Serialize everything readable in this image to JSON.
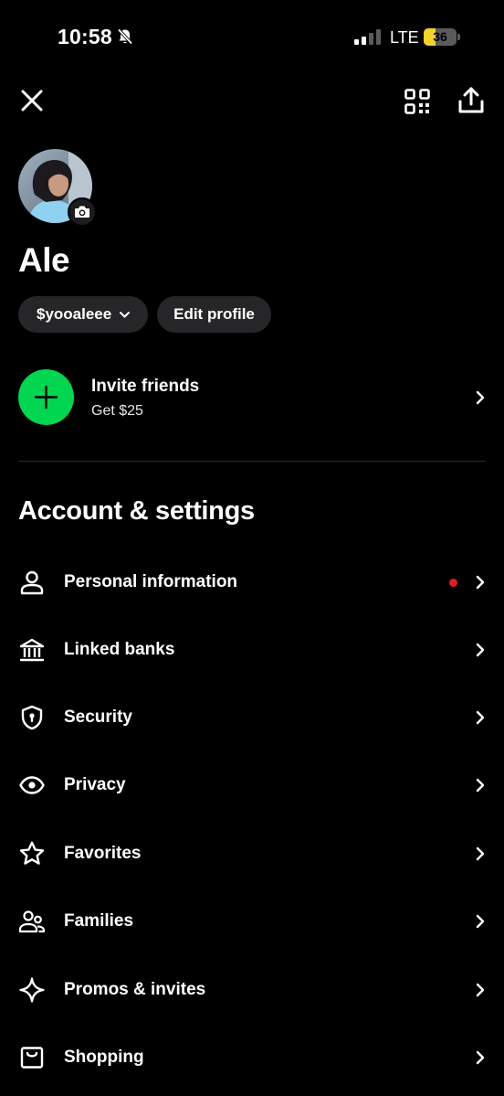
{
  "status_bar": {
    "time": "10:58",
    "network": "LTE",
    "battery_percent": "36",
    "battery_level": 0.36,
    "battery_color": "#f5d228",
    "icons": [
      "bell-slash-icon",
      "cellular-signal-icon",
      "battery-icon"
    ]
  },
  "top_bar": {
    "icons": [
      "close-icon",
      "qr-code-icon",
      "share-icon"
    ]
  },
  "profile": {
    "name": "Ale",
    "cashtag": "$yooaleee",
    "edit_label": "Edit profile",
    "icons": [
      "avatar-photo",
      "camera-icon",
      "chevron-down-icon"
    ]
  },
  "invite": {
    "title": "Invite friends",
    "subtitle": "Get $25",
    "accent_color": "#00d64f",
    "icon": "plus-icon"
  },
  "settings": {
    "section_title": "Account & settings",
    "items": [
      {
        "label": "Personal information",
        "icon": "person-icon",
        "notification": true
      },
      {
        "label": "Linked banks",
        "icon": "bank-icon"
      },
      {
        "label": "Security",
        "icon": "shield-icon"
      },
      {
        "label": "Privacy",
        "icon": "eye-icon"
      },
      {
        "label": "Favorites",
        "icon": "star-icon"
      },
      {
        "label": "Families",
        "icon": "family-icon"
      },
      {
        "label": "Promos & invites",
        "icon": "sparkle-icon"
      },
      {
        "label": "Shopping",
        "icon": "shopping-bag-icon"
      }
    ],
    "notification_color": "#e21d1d"
  }
}
